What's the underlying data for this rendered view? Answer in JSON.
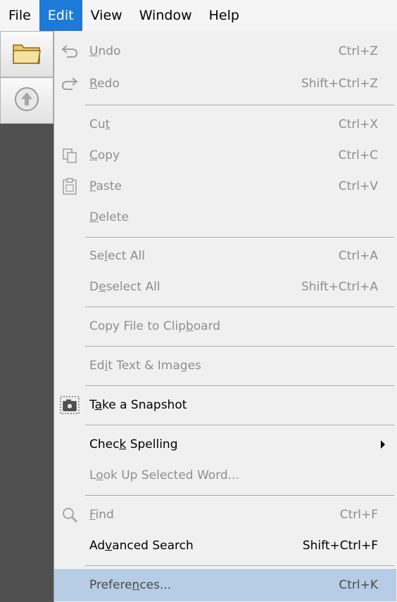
{
  "menubar": {
    "items": [
      {
        "label": "File",
        "active": false
      },
      {
        "label": "Edit",
        "active": true
      },
      {
        "label": "View",
        "active": false
      },
      {
        "label": "Window",
        "active": false
      },
      {
        "label": "Help",
        "active": false
      }
    ]
  },
  "toolbar": {
    "open_icon": "folder-icon",
    "up_icon": "up-arrow-icon"
  },
  "menu": {
    "items": [
      {
        "pre": "",
        "u": "U",
        "post": "ndo",
        "shortcut": "Ctrl+Z",
        "disabled": true,
        "icon": "undo-icon"
      },
      {
        "pre": "",
        "u": "R",
        "post": "edo",
        "shortcut": "Shift+Ctrl+Z",
        "disabled": true,
        "icon": "redo-icon"
      },
      {
        "pre": "Cu",
        "u": "t",
        "post": "",
        "shortcut": "Ctrl+X",
        "disabled": true,
        "icon": ""
      },
      {
        "pre": "",
        "u": "C",
        "post": "opy",
        "shortcut": "Ctrl+C",
        "disabled": true,
        "icon": "copy-icon"
      },
      {
        "pre": "",
        "u": "P",
        "post": "aste",
        "shortcut": "Ctrl+V",
        "disabled": true,
        "icon": "paste-icon"
      },
      {
        "pre": "",
        "u": "D",
        "post": "elete",
        "shortcut": "",
        "disabled": true,
        "icon": ""
      },
      {
        "pre": "Se",
        "u": "l",
        "post": "ect All",
        "shortcut": "Ctrl+A",
        "disabled": true,
        "icon": ""
      },
      {
        "pre": "D",
        "u": "e",
        "post": "select All",
        "shortcut": "Shift+Ctrl+A",
        "disabled": true,
        "icon": ""
      },
      {
        "pre": "Copy File to Clip",
        "u": "b",
        "post": "oard",
        "shortcut": "",
        "disabled": true,
        "icon": ""
      },
      {
        "pre": "Ed",
        "u": "i",
        "post": "t Text & Images",
        "shortcut": "",
        "disabled": true,
        "icon": ""
      },
      {
        "pre": "T",
        "u": "a",
        "post": "ke a Snapshot",
        "shortcut": "",
        "disabled": false,
        "icon": "camera-icon"
      },
      {
        "pre": "Chec",
        "u": "k",
        "post": " Spelling",
        "shortcut": "",
        "disabled": false,
        "icon": "",
        "submenu": true
      },
      {
        "pre": "L",
        "u": "o",
        "post": "ok Up Selected Word...",
        "shortcut": "",
        "disabled": true,
        "icon": ""
      },
      {
        "pre": "",
        "u": "F",
        "post": "ind",
        "shortcut": "Ctrl+F",
        "disabled": true,
        "icon": "magnifier-icon"
      },
      {
        "pre": "Ad",
        "u": "v",
        "post": "anced Search",
        "shortcut": "Shift+Ctrl+F",
        "disabled": false,
        "icon": ""
      },
      {
        "pre": "Prefere",
        "u": "n",
        "post": "ces...",
        "shortcut": "Ctrl+K",
        "disabled": false,
        "icon": "",
        "highlighted": true
      }
    ]
  }
}
